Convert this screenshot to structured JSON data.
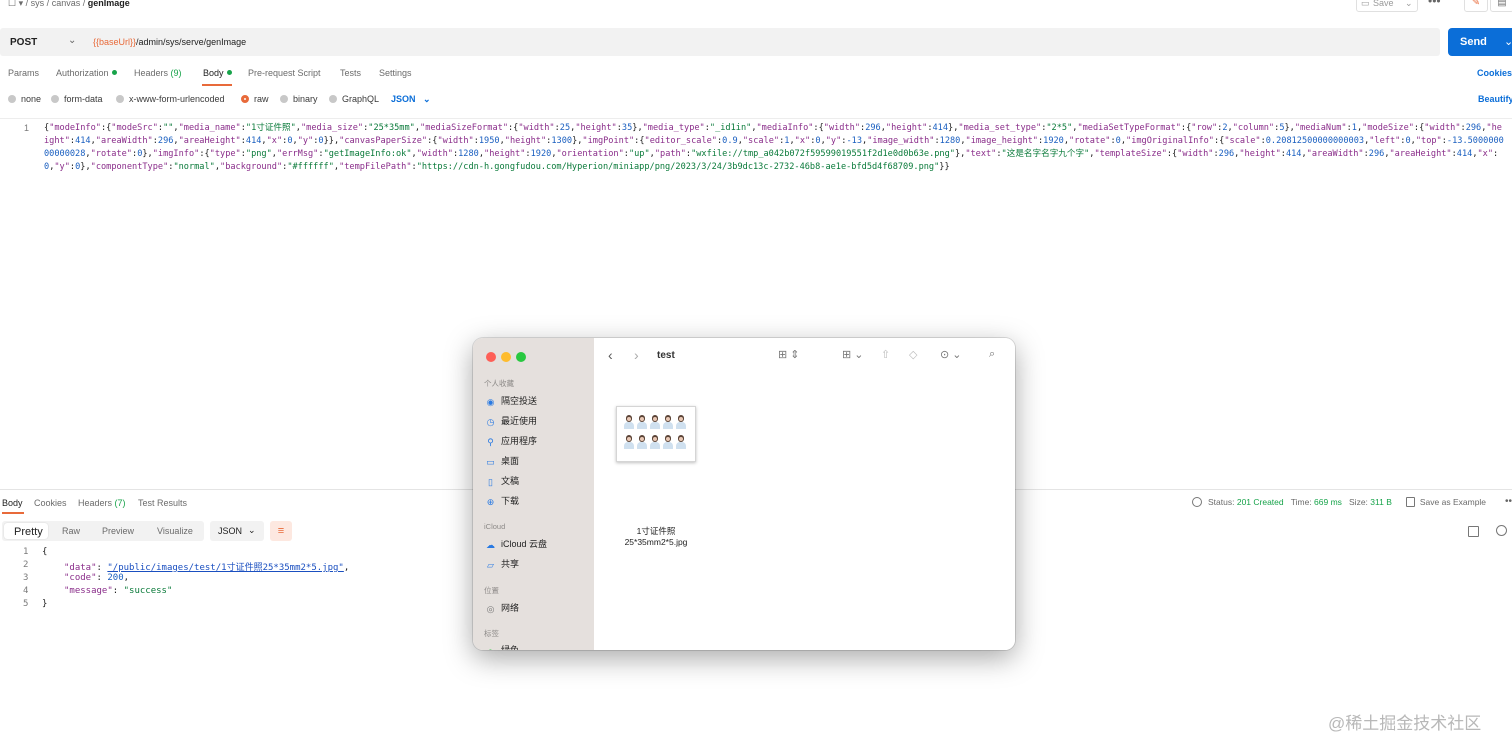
{
  "breadcrumb": {
    "sep": "/",
    "parts": [
      "sys",
      "canvas"
    ],
    "current": "genImage"
  },
  "toolbar": {
    "save_label": "Save",
    "more": "•••"
  },
  "request": {
    "method": "POST",
    "url_var": "{{baseUrl}}",
    "url_path": "/admin/sys/serve/genImage",
    "send_label": "Send"
  },
  "tabs": [
    {
      "label": "Params"
    },
    {
      "label": "Authorization"
    },
    {
      "label": "Headers",
      "count": "(9)"
    },
    {
      "label": "Body"
    },
    {
      "label": "Pre-request Script"
    },
    {
      "label": "Tests"
    },
    {
      "label": "Settings"
    }
  ],
  "cookies_label": "Cookies",
  "body_modes": [
    "none",
    "form-data",
    "x-www-form-urlencoded",
    "raw",
    "binary",
    "GraphQL"
  ],
  "body_format": "JSON",
  "beautify_label": "Beautify",
  "editor": {
    "line": "1"
  },
  "response": {
    "tabs": [
      {
        "label": "Body"
      },
      {
        "label": "Cookies"
      },
      {
        "label": "Headers",
        "count": "(7)"
      },
      {
        "label": "Test Results"
      }
    ],
    "status_label": "Status:",
    "status_value": "201 Created",
    "time_label": "Time:",
    "time_value": "669 ms",
    "size_label": "Size:",
    "size_value": "311 B",
    "save_example": "Save as Example",
    "view_tabs": [
      "Pretty",
      "Raw",
      "Preview",
      "Visualize"
    ],
    "format": "JSON",
    "lines": [
      "1",
      "2",
      "3",
      "4",
      "5"
    ],
    "json": {
      "open": "{",
      "k_data": "\"data\"",
      "v_data": "\"/public/images/test/1寸证件照25*35mm2*5.jpg\"",
      "k_code": "\"code\"",
      "v_code": "200",
      "k_message": "\"message\"",
      "v_message": "\"success\"",
      "close": "}"
    }
  },
  "finder": {
    "title": "test",
    "sections": {
      "favorites": "个人收藏",
      "icloud": "iCloud",
      "locations": "位置",
      "tags": "标签"
    },
    "favorites": [
      "隔空投送",
      "最近使用",
      "应用程序",
      "桌面",
      "文稿",
      "下载"
    ],
    "icloud_items": [
      "iCloud 云盘",
      "共享"
    ],
    "location_items": [
      "网络"
    ],
    "tag_items": [
      "绿色"
    ],
    "file_name_line1": "1寸证件照",
    "file_name_line2": "25*35mm2*5.jpg"
  },
  "watermark": "@稀土掘金技术社区",
  "colors": {
    "accent": "#e86a3a",
    "send": "#0b6ed8",
    "green": "#17a34a"
  }
}
